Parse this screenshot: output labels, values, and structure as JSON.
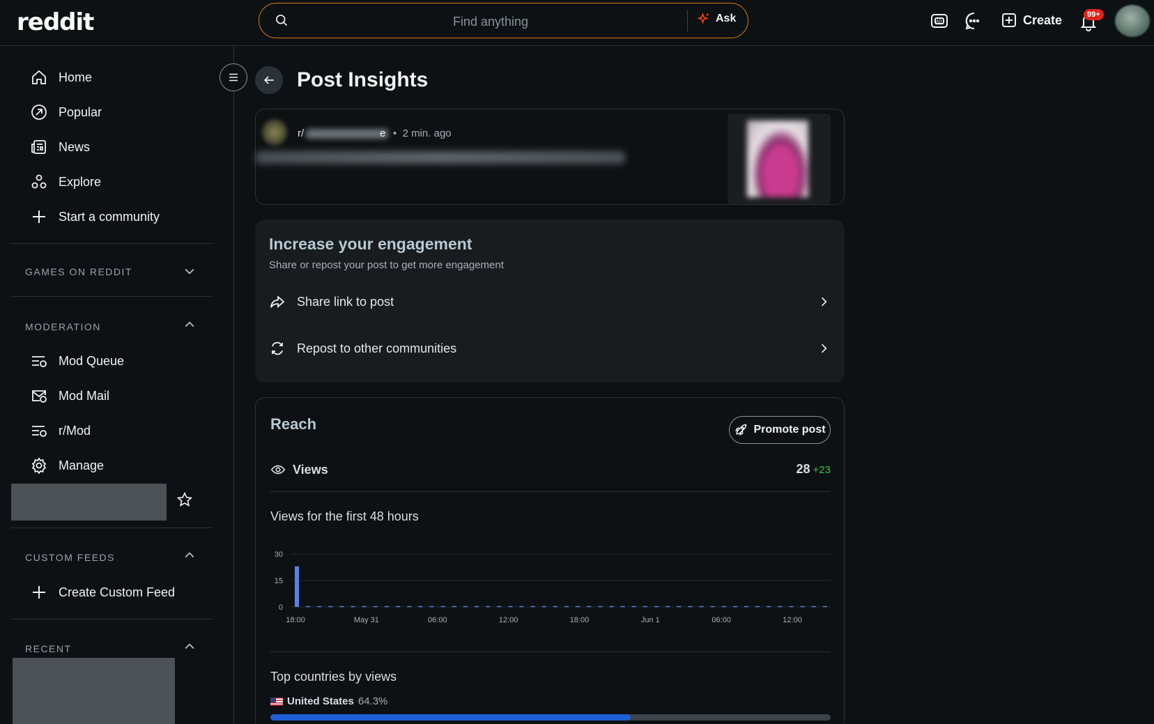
{
  "header": {
    "logo": "reddit",
    "search_placeholder": "Find anything",
    "ask_label": "Ask",
    "create_label": "Create",
    "notification_badge": "99+"
  },
  "sidebar": {
    "nav": [
      {
        "label": "Home",
        "icon": "home-icon"
      },
      {
        "label": "Popular",
        "icon": "popular-icon"
      },
      {
        "label": "News",
        "icon": "news-icon"
      },
      {
        "label": "Explore",
        "icon": "explore-icon"
      },
      {
        "label": "Start a community",
        "icon": "plus-icon"
      }
    ],
    "games_title": "GAMES ON REDDIT",
    "moderation_title": "MODERATION",
    "moderation_items": [
      {
        "label": "Mod Queue",
        "icon": "mod-queue-icon"
      },
      {
        "label": "Mod Mail",
        "icon": "mod-mail-icon"
      },
      {
        "label": "r/Mod",
        "icon": "mod-feed-icon"
      },
      {
        "label": "Manage",
        "icon": "gear-icon"
      }
    ],
    "custom_feeds_title": "CUSTOM FEEDS",
    "create_custom_feed": "Create Custom Feed",
    "recent_title": "RECENT"
  },
  "main": {
    "title": "Post Insights",
    "post": {
      "subreddit_prefix": "r/",
      "subreddit_suffix": "e",
      "time": "2 min. ago"
    },
    "engagement": {
      "title": "Increase your engagement",
      "subtitle": "Share or repost your post to get more engagement",
      "share_label": "Share link to post",
      "repost_label": "Repost to other communities"
    },
    "reach": {
      "title": "Reach",
      "promote_label": "Promote post",
      "views_label": "Views",
      "views_value": "28",
      "views_delta": "+23",
      "chart_title": "Views for the first 48 hours",
      "countries_title": "Top countries by views",
      "top_country": {
        "name": "United States",
        "percent_label": "64.3%",
        "fraction": 0.643
      }
    }
  },
  "chart_data": {
    "type": "bar",
    "title": "Views for the first 48 hours",
    "x_tick_labels": [
      "18:00",
      "May 31",
      "06:00",
      "12:00",
      "18:00",
      "Jun 1",
      "06:00",
      "12:00"
    ],
    "y_tick_labels": [
      "30",
      "15",
      "0"
    ],
    "ylim": [
      0,
      30
    ],
    "values": [
      23,
      0,
      0,
      0,
      0,
      0,
      0,
      0,
      0,
      0,
      0,
      0,
      0,
      0,
      0,
      0,
      0,
      0,
      0,
      0,
      0,
      0,
      0,
      0,
      0,
      0,
      0,
      0,
      0,
      0,
      0,
      0,
      0,
      0,
      0,
      0,
      0,
      0,
      0,
      0,
      0,
      0,
      0,
      0,
      0,
      0,
      0,
      0
    ],
    "colors": {
      "bar": "#5b7fe8"
    }
  }
}
